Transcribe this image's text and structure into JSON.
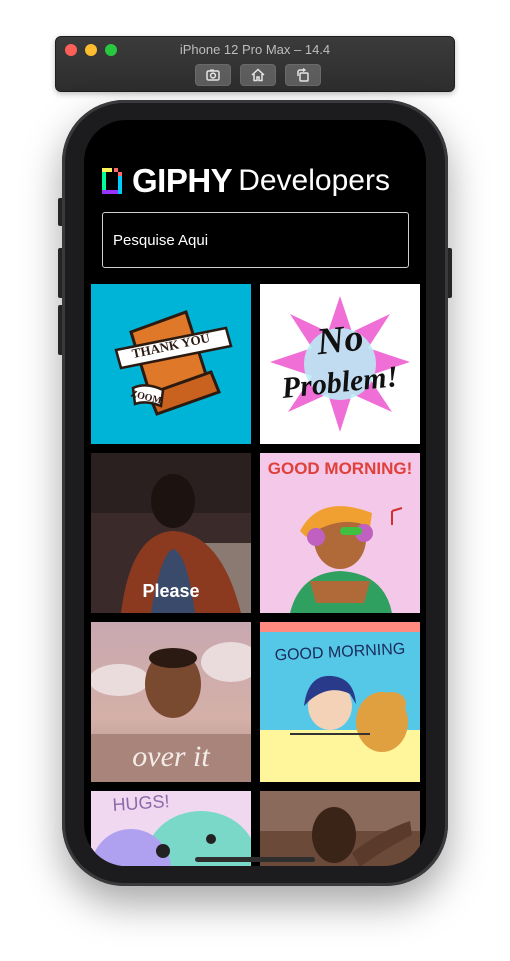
{
  "window": {
    "title": "iPhone 12 Pro Max – 14.4",
    "buttons": [
      "screenshot-icon",
      "home-icon",
      "rotate-icon"
    ]
  },
  "app": {
    "logo_brand": "GIPHY",
    "logo_suffix": "Developers",
    "search_placeholder": "Pesquise Aqui"
  },
  "gifs": [
    {
      "text": "THANK YOU",
      "sub": "ZOOM",
      "bg": "#00b4d8"
    },
    {
      "text": "No",
      "sub": "Problem!",
      "bg": "#ffffff"
    },
    {
      "text": "Please",
      "bg": "#3b2a2a"
    },
    {
      "text": "GOOD MORNING!",
      "bg": "#f4c8e8"
    },
    {
      "text": "over it",
      "bg": "#c9a0a0"
    },
    {
      "text": "GOOD MORNING",
      "bg": "#ff8a80"
    },
    {
      "text": "HUGS!",
      "bg": "#f0d8f0"
    },
    {
      "text": "",
      "bg": "#6b4a3a"
    }
  ]
}
